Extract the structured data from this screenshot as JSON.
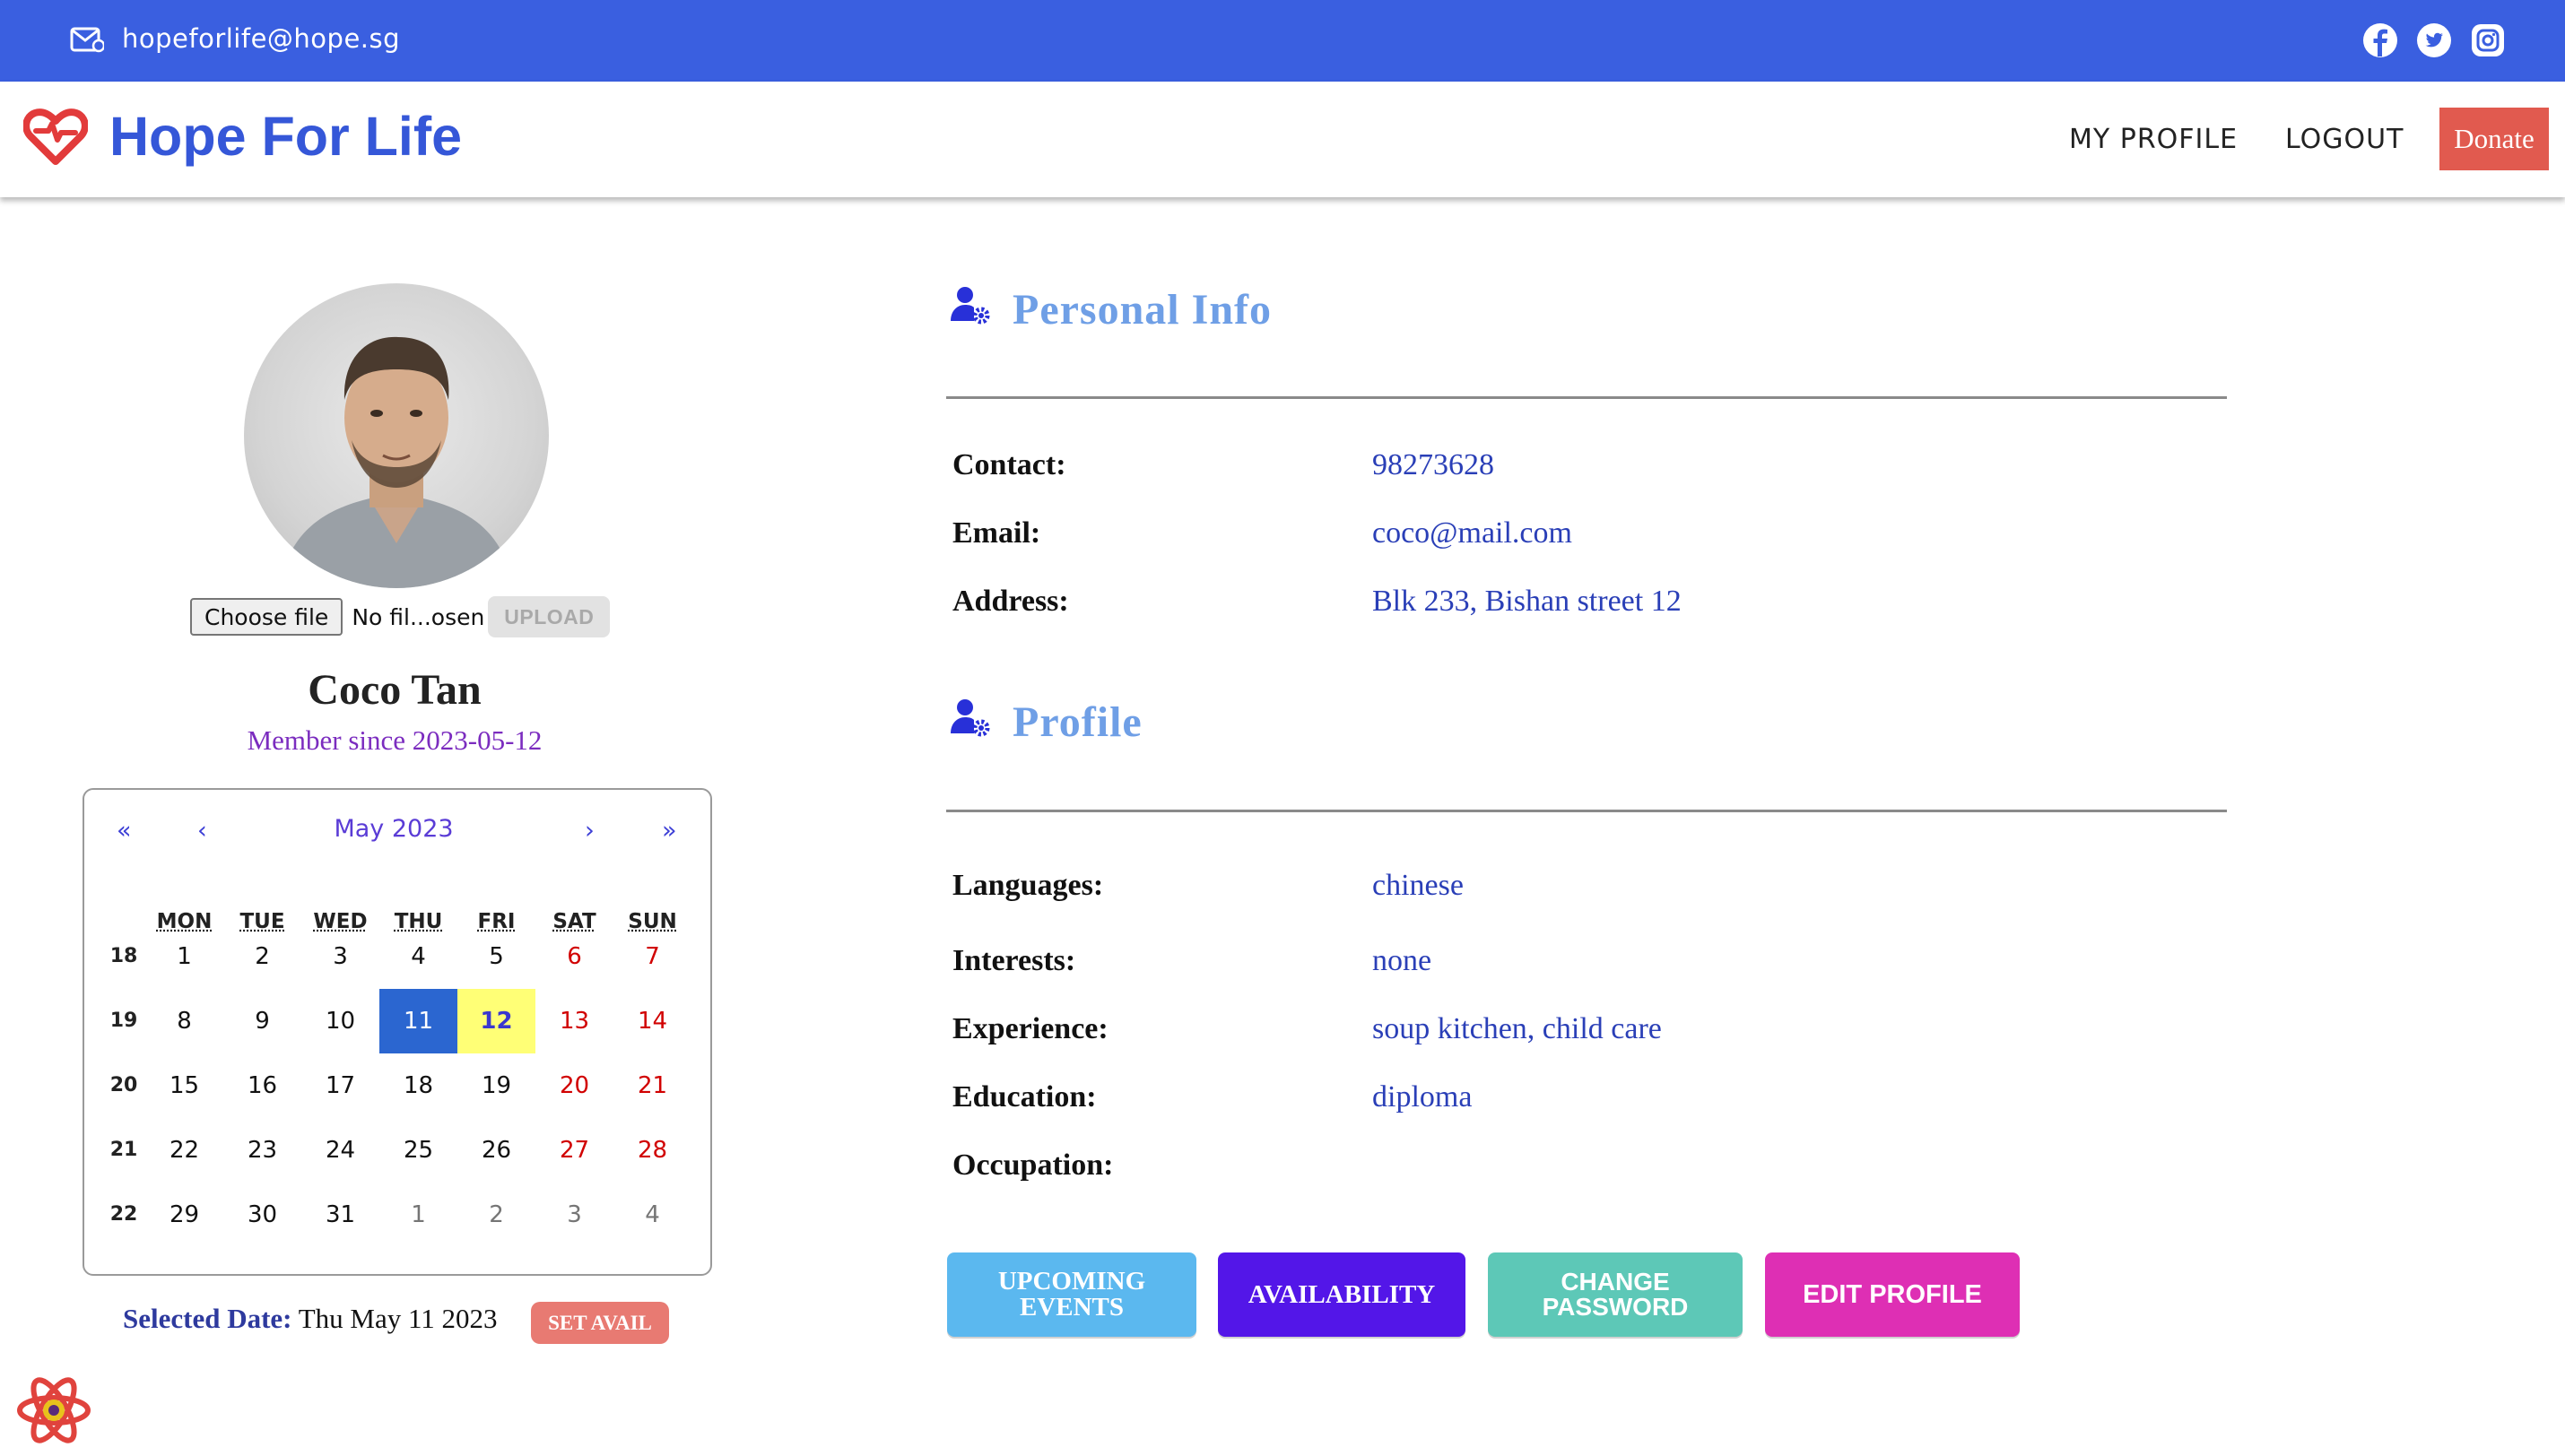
{
  "topbar": {
    "email": "hopeforlife@hope.sg",
    "icons": [
      "mail-icon",
      "facebook-icon",
      "twitter-icon",
      "instagram-icon"
    ],
    "color": "#3a5fe0"
  },
  "navbar": {
    "brand": "Hope For Life",
    "links": {
      "my_profile": "MY PROFILE",
      "logout": "LOGOUT",
      "donate": "Donate"
    },
    "brand_color": "#3557d8",
    "donate_color": "#e15a4f"
  },
  "profile": {
    "choose_file": "Choose file",
    "no_file": "No fil...osen",
    "upload": "UPLOAD",
    "name": "Coco Tan",
    "member_since": "Member since 2023-05-12"
  },
  "calendar": {
    "nav": {
      "prev_year": "«",
      "prev_month": "‹",
      "next_month": "›",
      "next_year": "»"
    },
    "month": "May 2023",
    "weekdays": [
      "MON",
      "TUE",
      "WED",
      "THU",
      "FRI",
      "SAT",
      "SUN"
    ],
    "weeks": [
      {
        "num": "18",
        "days": [
          "1",
          "2",
          "3",
          "4",
          "5",
          "6",
          "7"
        ]
      },
      {
        "num": "19",
        "days": [
          "8",
          "9",
          "10",
          "11",
          "12",
          "13",
          "14"
        ]
      },
      {
        "num": "20",
        "days": [
          "15",
          "16",
          "17",
          "18",
          "19",
          "20",
          "21"
        ]
      },
      {
        "num": "21",
        "days": [
          "22",
          "23",
          "24",
          "25",
          "26",
          "27",
          "28"
        ]
      },
      {
        "num": "22",
        "days": [
          "29",
          "30",
          "31",
          "1",
          "2",
          "3",
          "4"
        ]
      }
    ],
    "selected_day": "11",
    "today": "12",
    "active_color": "#2b66d0",
    "today_color": "#ffff76"
  },
  "selected": {
    "label": "Selected Date:",
    "value": "Thu May 11 2023",
    "set_avail": "SET AVAIL"
  },
  "personal_info": {
    "title": "Personal Info",
    "fields": [
      {
        "label": "Contact:",
        "value": "98273628"
      },
      {
        "label": "Email:",
        "value": "coco@mail.com"
      },
      {
        "label": "Address:",
        "value": "Blk 233, Bishan street 12"
      }
    ]
  },
  "profile_section": {
    "title": "Profile",
    "fields": [
      {
        "label": "Languages:",
        "value": "chinese"
      },
      {
        "label": "Interests:",
        "value": "none"
      },
      {
        "label": "Experience:",
        "value": "soup kitchen, child care"
      },
      {
        "label": "Education:",
        "value": "diploma"
      },
      {
        "label": "Occupation:",
        "value": ""
      }
    ]
  },
  "actions": {
    "upcoming_events": "UPCOMING EVENTS",
    "availability": "AVAILABILITY",
    "change_password": "CHANGE PASSWORD",
    "edit_profile": "EDIT PROFILE",
    "colors": {
      "upcoming": "#5bb8ef",
      "availability": "#5316e8",
      "change_password": "#5dc8b7",
      "edit_profile": "#de2fb4"
    }
  }
}
